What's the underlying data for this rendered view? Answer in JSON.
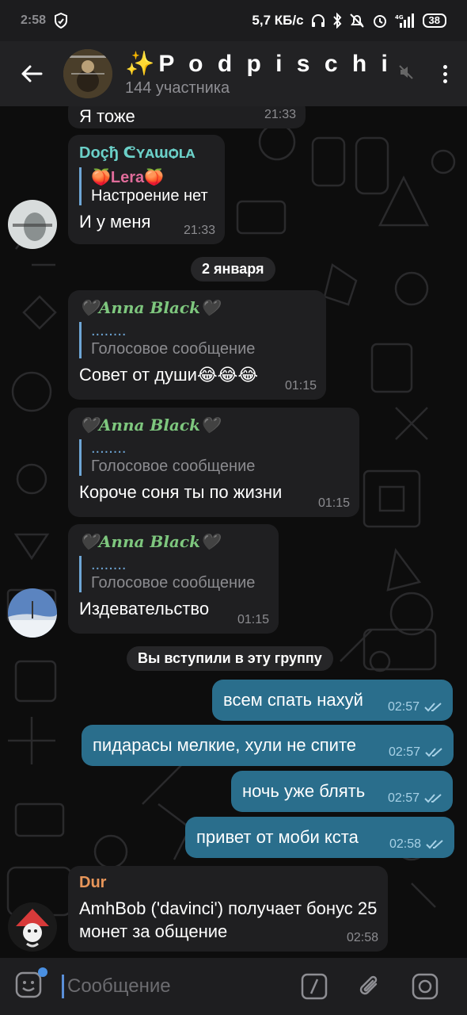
{
  "status": {
    "time": "2:58",
    "speed": "5,7 КБ/с",
    "battery": "38"
  },
  "header": {
    "title": "✨P o d p i s c h i k…",
    "subtitle": "144 участника"
  },
  "messages": {
    "m1": {
      "text": "Я тоже",
      "time": "21:33"
    },
    "m2": {
      "sender": "Dᴏçђ ᕦʏᴀɯѻʟᴀ",
      "reply_name": "🍑Lera🍑",
      "reply_text": "Настроение нет",
      "text": "И у меня",
      "time": "21:33"
    },
    "date_sep": "2 января",
    "m3": {
      "sender": "🖤Anna Black🖤",
      "reply_name": "........",
      "reply_text": "Голосовое сообщение",
      "text": "Совет от души😂😂😂",
      "time": "01:15"
    },
    "m4": {
      "sender": "🖤Anna Black🖤",
      "reply_name": "........",
      "reply_text": "Голосовое сообщение",
      "text": "Короче соня ты по жизни",
      "time": "01:15"
    },
    "m5": {
      "sender": "🖤Anna Black🖤",
      "reply_name": "........",
      "reply_text": "Голосовое сообщение",
      "text": "Издевательство",
      "time": "01:15"
    },
    "service": "Вы вступили в эту группу",
    "o1": {
      "text": "всем спать нахуй",
      "time": "02:57"
    },
    "o2": {
      "text": "пидарасы мелкие, хули не спите",
      "time": "02:57"
    },
    "o3": {
      "text": "ночь уже блять",
      "time": "02:57"
    },
    "o4": {
      "text": "привет от моби кста",
      "time": "02:58"
    },
    "m6": {
      "sender": "Dur",
      "text": "AmhBob ('davinci') получает бонус 25 монет за общение",
      "time": "02:58"
    }
  },
  "input": {
    "placeholder": "Сообщение"
  },
  "colors": {
    "outgoing": "#2a6e8c",
    "incoming": "#1f1f21",
    "accent": "#6ea6d6",
    "dur": "#e8965a",
    "dosh": "#6bd0c8"
  }
}
